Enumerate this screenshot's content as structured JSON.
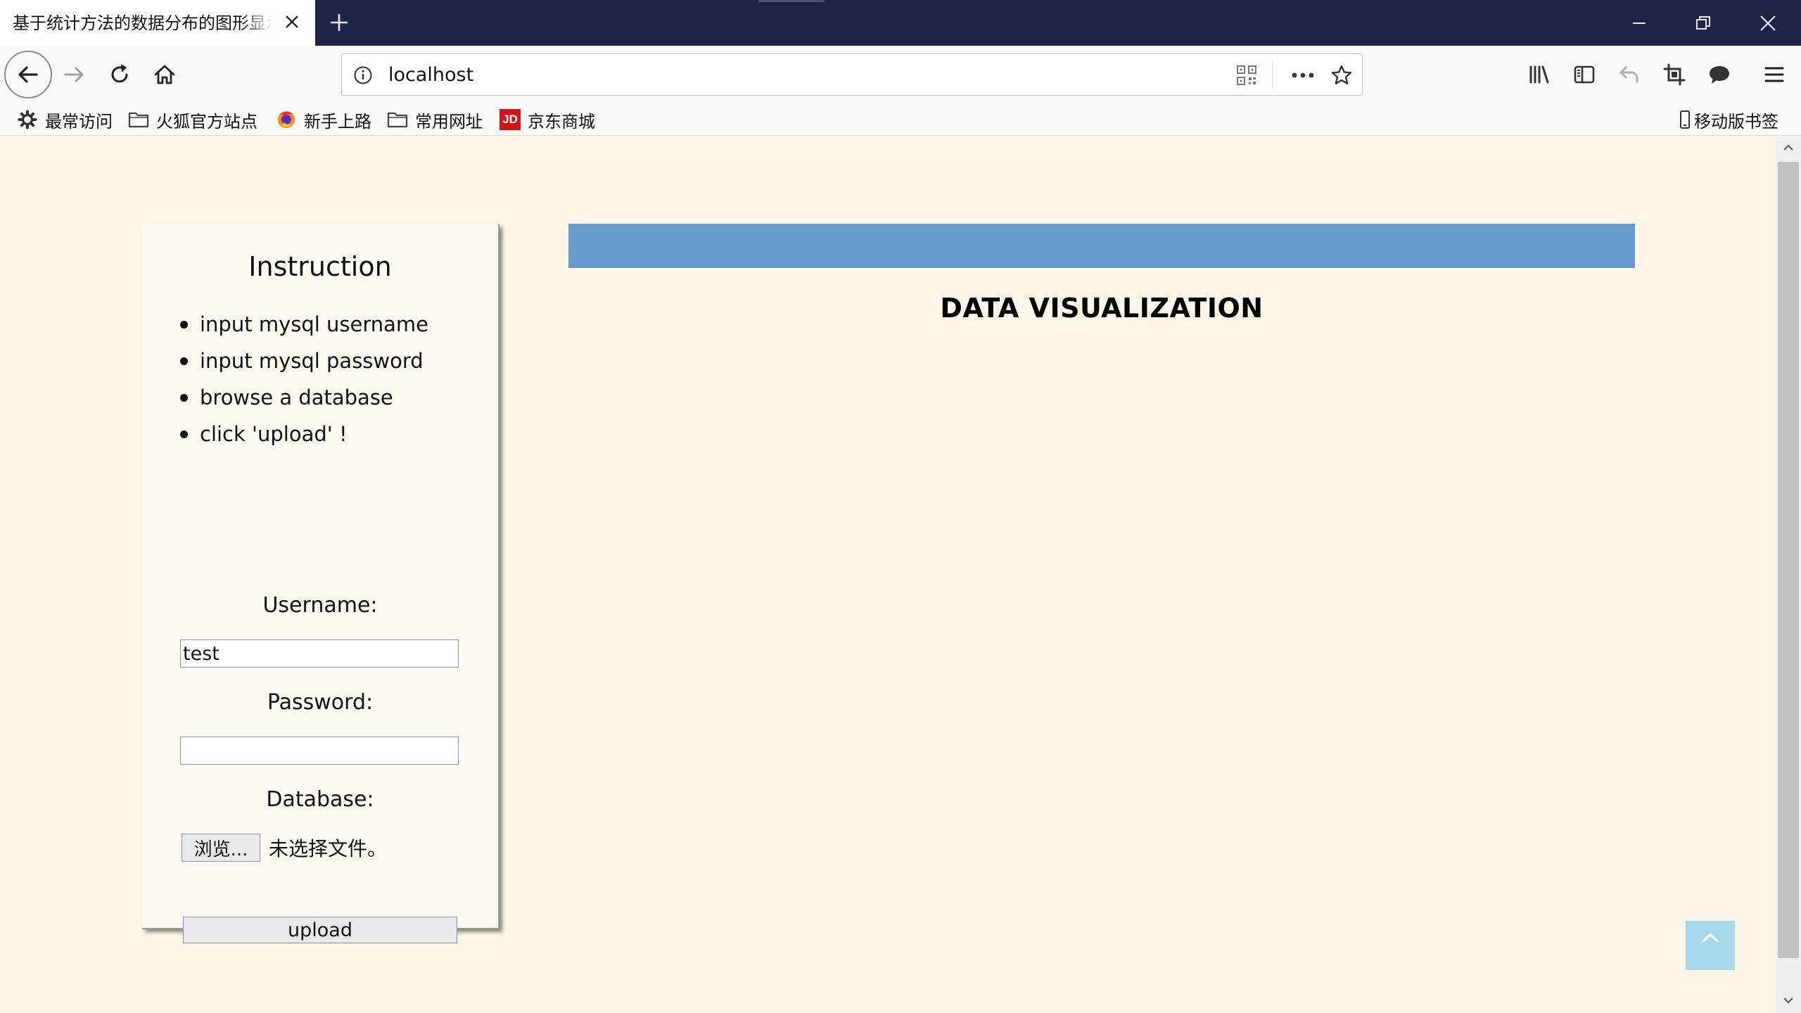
{
  "browser": {
    "tab_title": "基于统计方法的数据分布的图形显示",
    "url": "localhost",
    "bookmarks": [
      {
        "label": "最常访问",
        "icon": "gear-icon"
      },
      {
        "label": "火狐官方站点",
        "icon": "folder-icon"
      },
      {
        "label": "新手上路",
        "icon": "firefox-icon"
      },
      {
        "label": "常用网址",
        "icon": "folder-icon"
      },
      {
        "label": "京东商城",
        "icon": "jd-icon"
      }
    ],
    "mobile_bookmarks": "移动版书签",
    "jd_logo_text": "JD"
  },
  "page": {
    "instruction_title": "Instruction",
    "instructions": [
      "input mysql username",
      "input mysql password",
      "browse a database",
      "click 'upload' !"
    ],
    "username_label": "Username:",
    "username_value": "test",
    "password_label": "Password:",
    "password_value": "",
    "database_label": "Database:",
    "browse_button": "浏览...",
    "file_status": "未选择文件。",
    "upload_button": "upload",
    "viz_title": "DATA VISUALIZATION",
    "back_to_top": "^"
  },
  "colors": {
    "page_background": "#fdf5e6",
    "viz_bar": "#6699cc",
    "back_to_top": "#a5d8ea",
    "tabbar": "#1f2347"
  }
}
